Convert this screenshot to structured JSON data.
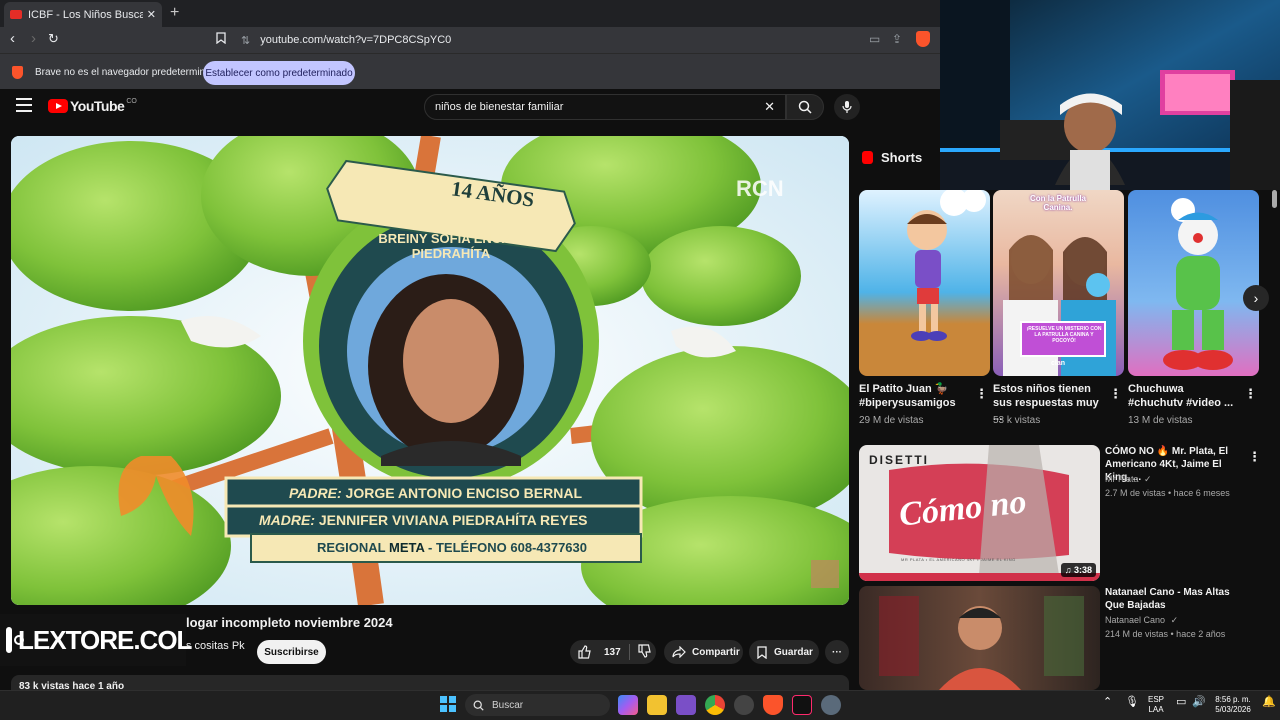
{
  "browser": {
    "tab_title": "ICBF - Los Niños Buscan Su Hog",
    "tab_close": "✕",
    "new_tab": "+",
    "url": "youtube.com/watch?v=7DPC8CSpYC0",
    "brave_badge": "",
    "infobar_message": "Brave no es el navegador predeterminado",
    "infobar_button": "Establecer como predeterminado"
  },
  "youtube": {
    "logo_text": "YouTube",
    "country": "CO",
    "search_value": "niños de bienestar familiar"
  },
  "video": {
    "overlay_age": "14 AÑOS",
    "overlay_name": "BREINY SOFÍA ENCISO PIEDRAHÍTA",
    "overlay_padre_label": "PADRE:",
    "overlay_padre": "JORGE ANTONIO ENCISO BERNAL",
    "overlay_madre_label": "MADRE:",
    "overlay_madre": "JENNIFER VIVIANA PIEDRAHÍTA REYES",
    "overlay_regional": "REGIONAL",
    "overlay_region": "META",
    "overlay_tel": "- TELÉFONO 608-4377630",
    "channel_watermark": "RCN",
    "title": "logar incompleto noviembre 2024",
    "channel": "s cositas Pk",
    "subscribe": "Suscribirse",
    "likes": "137",
    "share": "Compartir",
    "save": "Guardar",
    "more": "···",
    "views": "83 k vistas  hace 1 año",
    "stream_watermark": "LEXTORE.COL"
  },
  "shorts": {
    "header": "Shorts",
    "items": [
      {
        "title": "El Patito Juan 🦆 #biperysusamigos",
        "meta": "29 M de vistas"
      },
      {
        "title": "Estos niños tienen sus respuestas muy ...",
        "meta": "53 k vistas",
        "thumb_text": "Con la Patrulla Canina.",
        "thumb_badge": "¡RESUELVE UN MISTERIO CON LA PATRULLA CANINA Y POCOYÓ!",
        "thumb_logo": "clan"
      },
      {
        "title": "Chuchuwa #chuchutv #video ...",
        "meta": "13 M de vistas"
      }
    ]
  },
  "related": [
    {
      "title": "CÓMO NO 🔥 Mr. Plata, El Americano 4Kt, Jaime El King, ...",
      "channel": "Mr Plata",
      "meta": "2.7 M de vistas • hace 6 meses",
      "duration": "3:38",
      "thumb_brand": "DISETTI",
      "thumb_text": "Cómo no",
      "thumb_caption": "MR PLATA • EL AMERICANO 4KT • JAIME EL KING"
    },
    {
      "title": "Natanael Cano - Mas Altas Que Bajadas",
      "channel": "Natanael Cano",
      "meta": "214 M de vistas • hace 2 años"
    }
  ],
  "taskbar": {
    "search": "Buscar",
    "lang1": "ESP",
    "lang2": "LAA",
    "time": "8:56 p. m.",
    "date": "5/03/2026"
  },
  "colors": {
    "yt_red": "#ff0000",
    "brave_orange": "#fb542b",
    "infobar_button": "#c2c5ff",
    "leaf_green": "#8cc63f"
  }
}
